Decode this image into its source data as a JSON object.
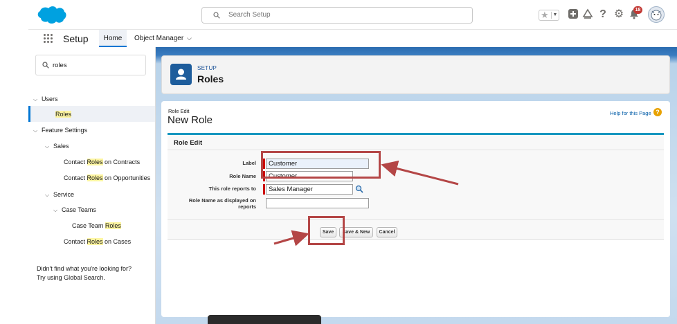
{
  "header": {
    "search_placeholder": "Search Setup",
    "notification_count": "18",
    "icons": [
      "favorites-star-icon",
      "add-icon",
      "trailhead-icon",
      "help-icon",
      "gear-icon",
      "bell-icon",
      "avatar-icon"
    ]
  },
  "nav": {
    "app_name": "Setup",
    "tabs": [
      {
        "label": "Home",
        "active": true
      },
      {
        "label": "Object Manager",
        "active": false
      }
    ]
  },
  "sidebar": {
    "search_value": "roles",
    "tree": [
      {
        "label": "Users",
        "level": 0,
        "expanded": true
      },
      {
        "pre": "",
        "hl": "Roles",
        "post": "",
        "level": 2,
        "selected": true
      },
      {
        "label": "Feature Settings",
        "level": 0,
        "expanded": true
      },
      {
        "label": "Sales",
        "level": 1,
        "expanded": true
      },
      {
        "pre": "Contact ",
        "hl": "Roles",
        "post": " on Contracts",
        "level": 3
      },
      {
        "pre": "Contact ",
        "hl": "Roles",
        "post": " on Opportunities",
        "level": 3
      },
      {
        "label": "Service",
        "level": 1,
        "expanded": true
      },
      {
        "label": "Case Teams",
        "level": 2,
        "expanded": true
      },
      {
        "pre": "Case Team ",
        "hl": "Roles",
        "post": "",
        "level": 4
      },
      {
        "pre": "Contact ",
        "hl": "Roles",
        "post": " on Cases",
        "level": 3
      }
    ],
    "not_found_line1": "Didn't find what you're looking for?",
    "not_found_line2": "Try using Global Search."
  },
  "page_header": {
    "eyebrow": "SETUP",
    "title": "Roles"
  },
  "role_edit": {
    "small_title": "Role Edit",
    "title": "New Role",
    "help_link": "Help for this Page",
    "section_title": "Role Edit",
    "fields": {
      "label": {
        "label": "Label",
        "value": "Customer"
      },
      "role_name": {
        "label": "Role Name",
        "value": "Customer"
      },
      "reports_to": {
        "label": "This role reports to",
        "value": "Sales Manager"
      },
      "display_name": {
        "label_line1": "Role Name as displayed on",
        "label_line2": "reports",
        "value": ""
      }
    },
    "buttons": {
      "save": "Save",
      "save_new": "Save & New",
      "cancel": "Cancel"
    }
  },
  "colors": {
    "accent": "#0176d3",
    "annotation": "#b44646",
    "section_border": "#1797c0"
  }
}
